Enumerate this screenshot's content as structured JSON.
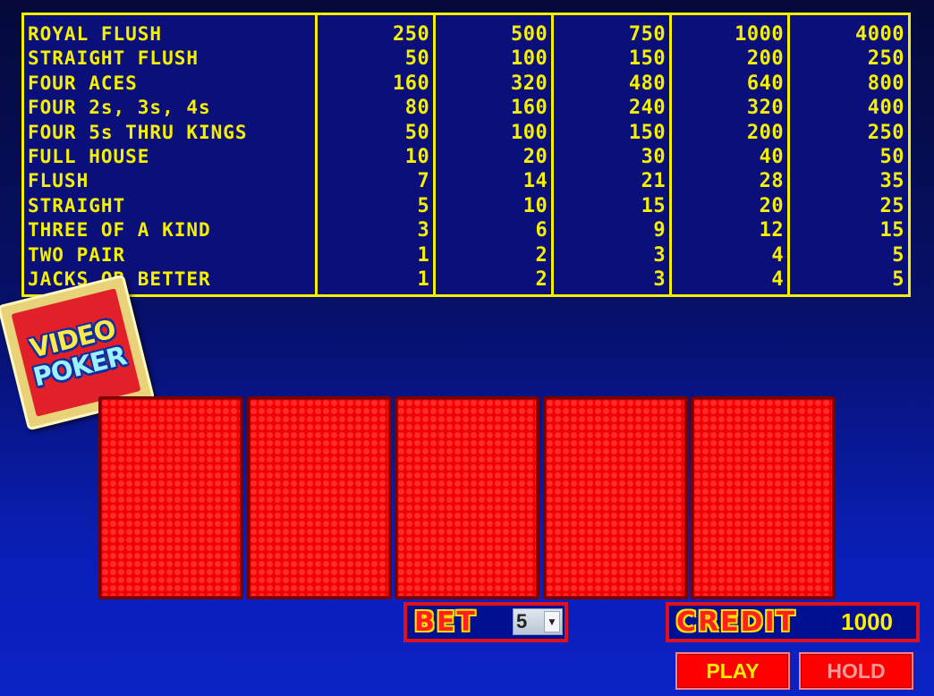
{
  "paytable": {
    "hands": [
      "ROYAL FLUSH",
      "STRAIGHT FLUSH",
      "FOUR ACES",
      "FOUR 2s, 3s, 4s",
      "FOUR 5s THRU KINGS",
      "FULL HOUSE",
      "FLUSH",
      "STRAIGHT",
      "THREE OF A KIND",
      "TWO PAIR",
      "JACKS OR BETTER"
    ],
    "columns": [
      [
        "250",
        "50",
        "160",
        "80",
        "50",
        "10",
        "7",
        "5",
        "3",
        "1",
        "1"
      ],
      [
        "500",
        "100",
        "320",
        "160",
        "100",
        "20",
        "14",
        "10",
        "6",
        "2",
        "2"
      ],
      [
        "750",
        "150",
        "480",
        "240",
        "150",
        "30",
        "21",
        "15",
        "9",
        "3",
        "3"
      ],
      [
        "1000",
        "200",
        "640",
        "320",
        "200",
        "40",
        "28",
        "20",
        "12",
        "4",
        "4"
      ],
      [
        "4000",
        "250",
        "800",
        "400",
        "250",
        "50",
        "35",
        "25",
        "15",
        "5",
        "5"
      ]
    ]
  },
  "logo": {
    "line1": "VIDEO",
    "line2": "POKER"
  },
  "cards": [
    {
      "state": "face-down"
    },
    {
      "state": "face-down"
    },
    {
      "state": "face-down"
    },
    {
      "state": "face-down"
    },
    {
      "state": "face-down"
    }
  ],
  "bet": {
    "label": "BET",
    "value": "5",
    "dropdown_icon": "chevron-down-icon"
  },
  "credit": {
    "label": "CREDIT",
    "value": "1000"
  },
  "buttons": {
    "play": "PLAY",
    "hold": "HOLD"
  },
  "colors": {
    "paytable_text": "#f5f000",
    "paytable_border": "#f5f000",
    "card_back": "#f00000",
    "button_bg": "#ff0000",
    "label_red": "#e0101c"
  }
}
